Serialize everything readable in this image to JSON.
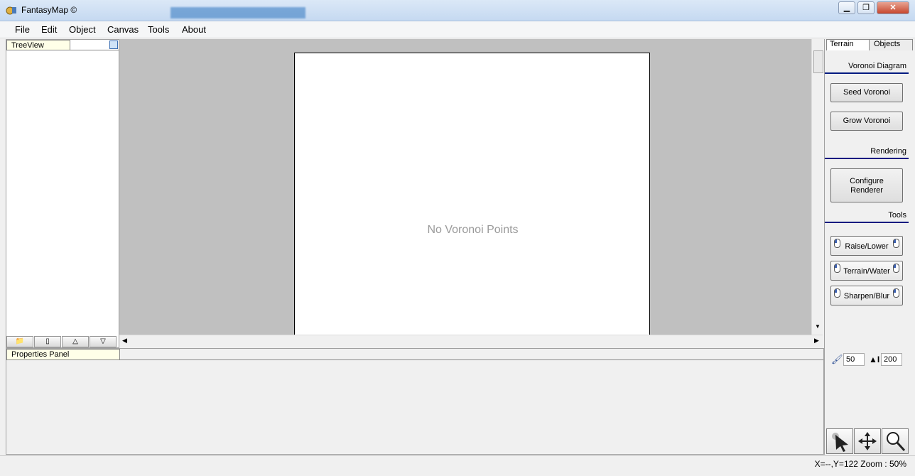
{
  "window": {
    "title": "FantasyMap ©",
    "close_glyph": "✕"
  },
  "menu": [
    "File",
    "Edit",
    "Object",
    "Canvas",
    "Tools",
    "About"
  ],
  "treeview": {
    "title": "TreeView"
  },
  "canvas": {
    "message": "No Voronoi Points"
  },
  "properties": {
    "title": "Properties Panel"
  },
  "right_panel": {
    "tabs": [
      "Terrain",
      "Objects"
    ],
    "voronoi_title": "Voronoi Diagram",
    "seed_btn": "Seed Voronoi",
    "grow_btn": "Grow Voronoi",
    "rendering_title": "Rendering",
    "configure_btn": "Configure Renderer",
    "tools_title": "Tools",
    "tool_buttons": [
      "Raise/Lower",
      "Terrain/Water",
      "Sharpen/Blur"
    ],
    "brush_radius": "50",
    "brush_strength": "200"
  },
  "status": {
    "text": "X=--,Y=122  Zoom : 50%"
  },
  "colors": {
    "section_line": "#001a80",
    "canvas_bg": "#c0c0c0"
  }
}
